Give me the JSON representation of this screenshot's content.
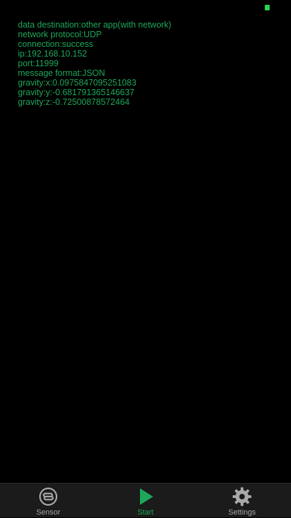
{
  "log": {
    "lines": [
      "data destination:other app(with network)",
      "network protocol:UDP",
      "connection:success",
      "ip:192.168.10.152",
      "port:11999",
      "message format:JSON",
      "gravity:x:0.0975847095251083",
      "gravity:y:-0.681791365146637",
      "gravity:z:-0.72500878572464"
    ]
  },
  "tabbar": {
    "tabs": [
      {
        "label": "Sensor",
        "icon": "sensor-icon",
        "active": false
      },
      {
        "label": "Start",
        "icon": "play-icon",
        "active": true
      },
      {
        "label": "Settings",
        "icon": "gear-icon",
        "active": false
      }
    ]
  },
  "colors": {
    "background": "#000000",
    "log_text": "#1ea75a",
    "status_indicator": "#2ad24e",
    "tabbar_background": "#1b1b1b",
    "tab_inactive": "#a9a9a9",
    "tab_active": "#1ea75a"
  }
}
